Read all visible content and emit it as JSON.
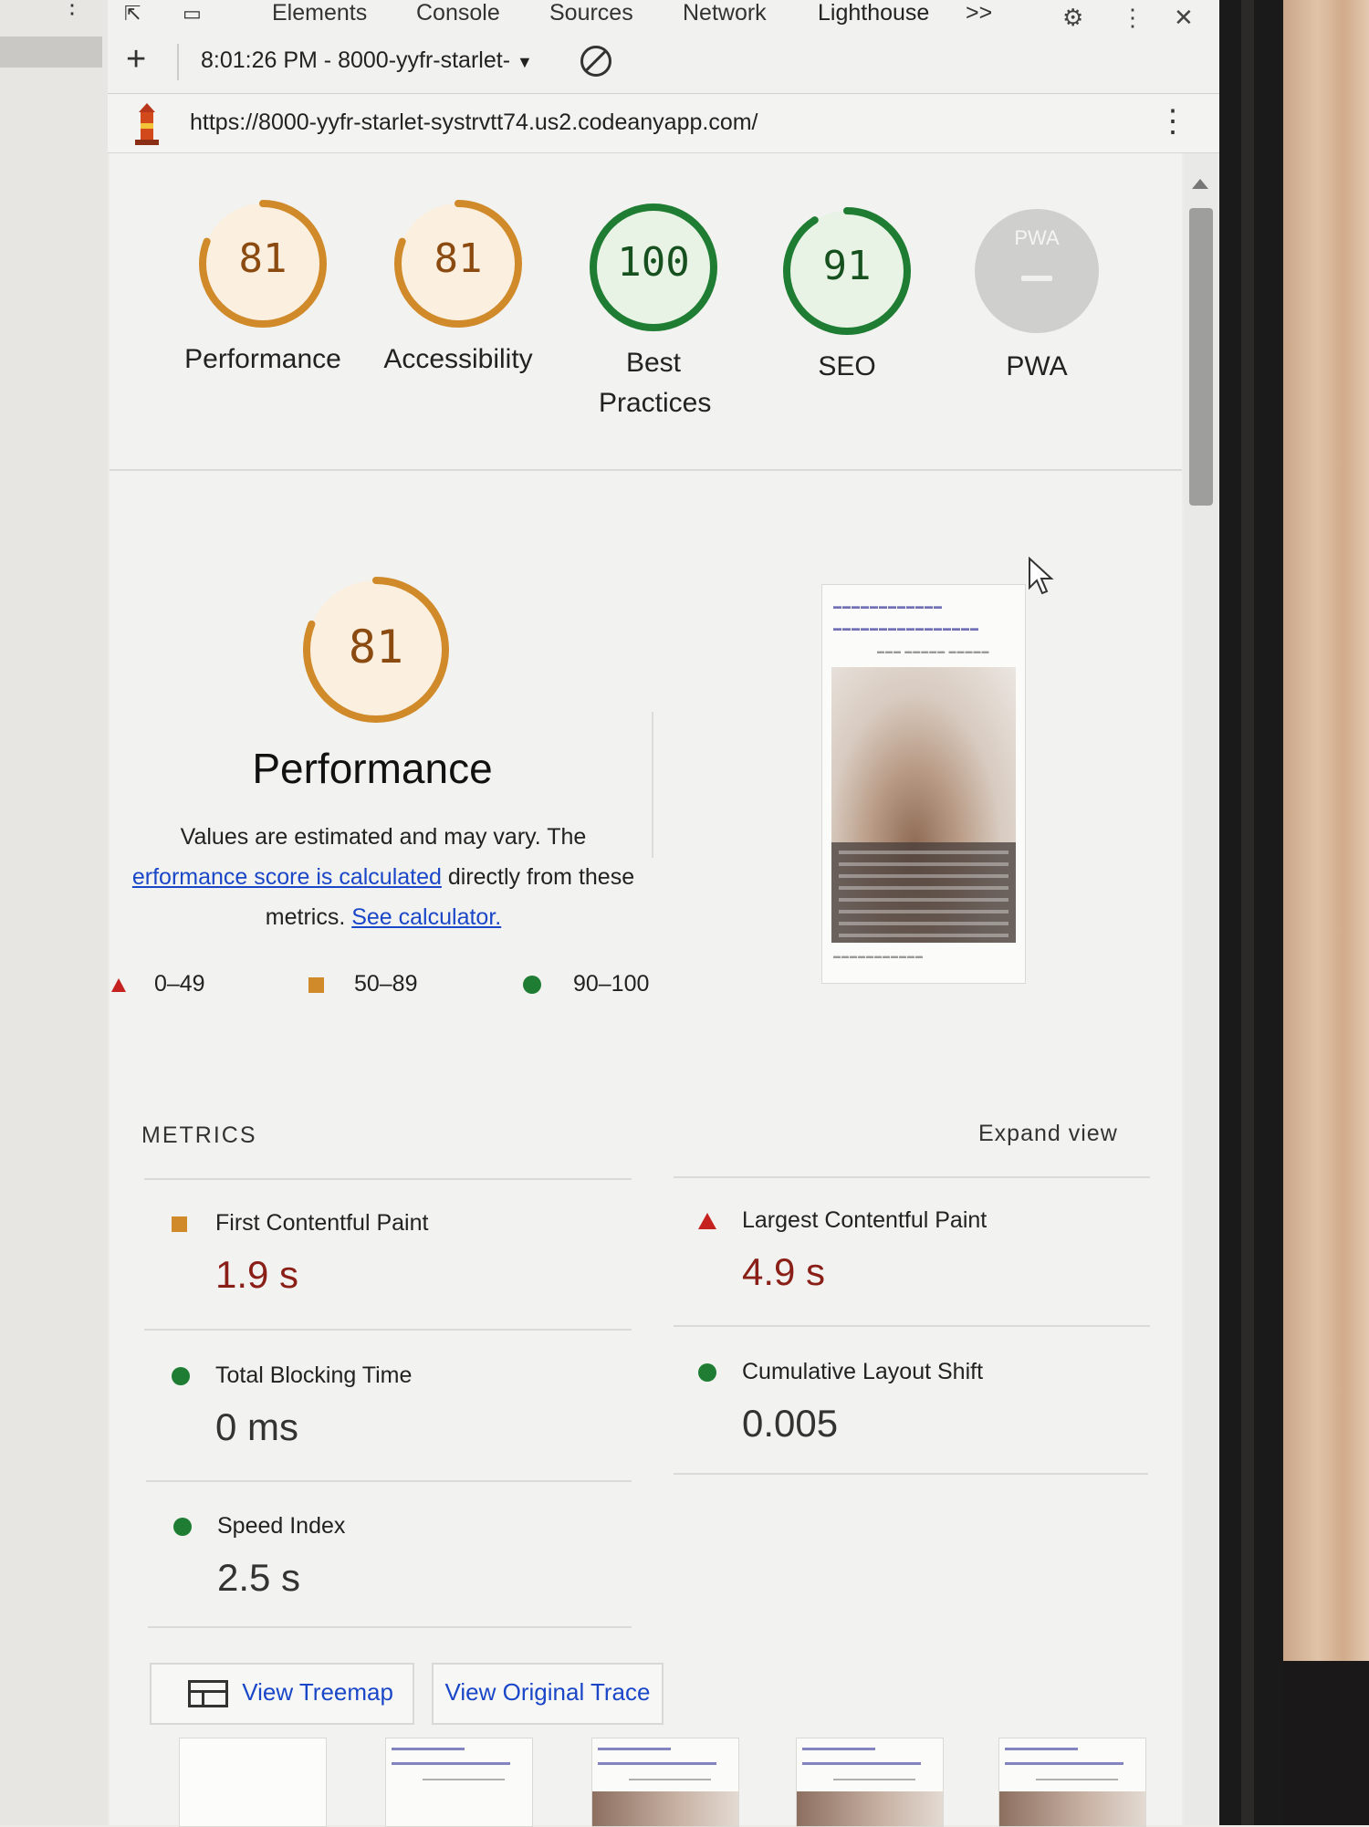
{
  "devtools": {
    "tabs": [
      "Elements",
      "Console",
      "Sources",
      "Network",
      "Lighthouse"
    ],
    "active_tab": "Lighthouse",
    "more_tabs": ">>",
    "session": {
      "add_label": "+",
      "time": "8:01:26 PM - 8000-yyfr-starlet-",
      "dropdown": "▼"
    },
    "url": "https://8000-yyfr-starlet-systrvtt74.us2.codeanyapp.com/"
  },
  "scores": [
    {
      "value": "81",
      "label": "Performance",
      "score": 81,
      "status": "average",
      "color": "#d08a2a"
    },
    {
      "value": "81",
      "label": "Accessibility",
      "score": 81,
      "status": "average",
      "color": "#d08a2a"
    },
    {
      "value": "100",
      "label": "Best Practices",
      "score": 100,
      "status": "pass",
      "color": "#1e7d32"
    },
    {
      "value": "91",
      "label": "SEO",
      "score": 91,
      "status": "pass",
      "color": "#1e7d32"
    },
    {
      "value": "PWA",
      "label": "PWA",
      "score": null,
      "status": "n/a",
      "color": "#cfcfcd"
    }
  ],
  "performance": {
    "score": "81",
    "title": "Performance",
    "desc_line1": "Values are estimated and may vary. The",
    "desc_link": "erformance score is calculated",
    "desc_rest": " directly from these",
    "desc_line3": "metrics.",
    "calculator_link": "See calculator.",
    "legend": [
      {
        "shape": "triangle",
        "range": "0–49",
        "color": "#c5221f"
      },
      {
        "shape": "square",
        "range": "50–89",
        "color": "#d08a2a"
      },
      {
        "shape": "circle",
        "range": "90–100",
        "color": "#1e7d32"
      }
    ]
  },
  "metrics": {
    "heading": "METRICS",
    "expand_label": "Expand view",
    "items": [
      {
        "name": "First Contentful Paint",
        "value": "1.9 s",
        "rating": "average"
      },
      {
        "name": "Largest Contentful Paint",
        "value": "4.9 s",
        "rating": "fail"
      },
      {
        "name": "Total Blocking Time",
        "value": "0 ms",
        "rating": "pass"
      },
      {
        "name": "Cumulative Layout Shift",
        "value": "0.005",
        "rating": "pass"
      },
      {
        "name": "Speed Index",
        "value": "2.5 s",
        "rating": "pass"
      }
    ]
  },
  "buttons": {
    "treemap": "View Treemap",
    "trace": "View Original Trace"
  },
  "colors": {
    "average": "#d08a2a",
    "pass": "#1e7d32",
    "fail": "#c5221f",
    "link": "#1a47c8"
  }
}
